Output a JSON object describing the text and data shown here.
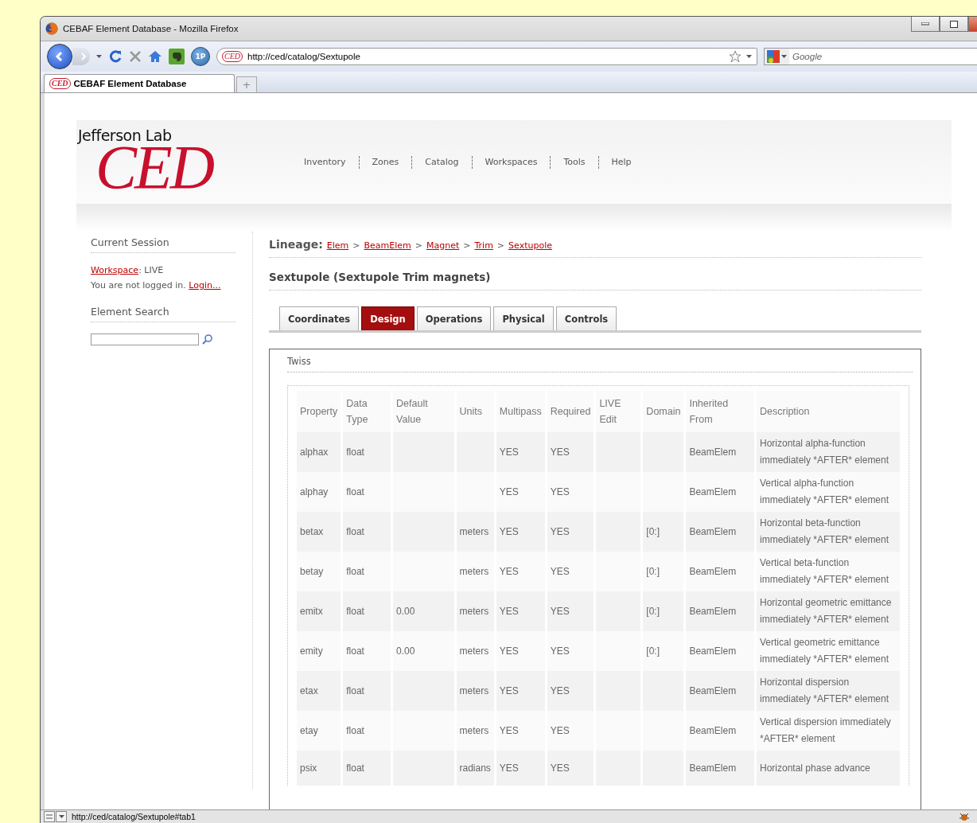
{
  "window": {
    "title": "CEBAF Element Database - Mozilla Firefox"
  },
  "toolbar": {
    "addon_label": "1P",
    "site_icon_text": "CED",
    "url": "http://ced/catalog/Sextupole",
    "search_placeholder": "Google"
  },
  "browser_tabs": [
    {
      "icon_text": "CED",
      "label": "CEBAF Element Database",
      "selected": true
    }
  ],
  "new_tab": "+",
  "header": {
    "logo_top": "Jefferson Lab",
    "logo_main": "CED",
    "nav": [
      "Inventory",
      "Zones",
      "Catalog",
      "Workspaces",
      "Tools",
      "Help"
    ]
  },
  "sidebar": {
    "session_title": "Current Session",
    "workspace_link": "Workspace",
    "workspace_value": ": LIVE",
    "login_text": "You are not logged in.",
    "login_link": "Login...",
    "search_title": "Element Search"
  },
  "lineage": {
    "label": "Lineage:",
    "crumbs": [
      "Elem",
      "BeamElem",
      "Magnet",
      "Trim",
      "Sextupole"
    ],
    "separator": ">"
  },
  "page_title": "Sextupole (Sextupole Trim magnets)",
  "tabs": [
    {
      "label": "Coordinates",
      "selected": false
    },
    {
      "label": "Design",
      "selected": true
    },
    {
      "label": "Operations",
      "selected": false
    },
    {
      "label": "Physical",
      "selected": false
    },
    {
      "label": "Controls",
      "selected": false
    }
  ],
  "panel": {
    "title": "Twiss",
    "columns": [
      "Property",
      "Data Type",
      "Default Value",
      "Units",
      "Multipass",
      "Required",
      "LIVE Edit",
      "Domain",
      "Inherited From",
      "Description"
    ],
    "rows": [
      {
        "property": "alphax",
        "data_type": "float",
        "multipass": "YES",
        "required": "YES",
        "inherited_from": "BeamElem",
        "description": "Horizontal alpha-function immediately *AFTER* element"
      },
      {
        "property": "alphay",
        "data_type": "float",
        "multipass": "YES",
        "required": "YES",
        "inherited_from": "BeamElem",
        "description": "Vertical alpha-function immediately *AFTER* element"
      },
      {
        "property": "betax",
        "data_type": "float",
        "units": "meters",
        "multipass": "YES",
        "required": "YES",
        "domain": "[0:]",
        "inherited_from": "BeamElem",
        "description": "Horizontal beta-function immediately *AFTER* element"
      },
      {
        "property": "betay",
        "data_type": "float",
        "units": "meters",
        "multipass": "YES",
        "required": "YES",
        "domain": "[0:]",
        "inherited_from": "BeamElem",
        "description": "Vertical beta-function immediately *AFTER* element"
      },
      {
        "property": "emitx",
        "data_type": "float",
        "default_value": "0.00",
        "units": "meters",
        "multipass": "YES",
        "required": "YES",
        "domain": "[0:]",
        "inherited_from": "BeamElem",
        "description": "Horizontal geometric emittance immediately *AFTER* element"
      },
      {
        "property": "emity",
        "data_type": "float",
        "default_value": "0.00",
        "units": "meters",
        "multipass": "YES",
        "required": "YES",
        "domain": "[0:]",
        "inherited_from": "BeamElem",
        "description": "Vertical geometric emittance immediately *AFTER* element"
      },
      {
        "property": "etax",
        "data_type": "float",
        "units": "meters",
        "multipass": "YES",
        "required": "YES",
        "inherited_from": "BeamElem",
        "description": "Horizontal dispersion immediately *AFTER* element"
      },
      {
        "property": "etay",
        "data_type": "float",
        "units": "meters",
        "multipass": "YES",
        "required": "YES",
        "inherited_from": "BeamElem",
        "description": "Vertical dispersion immediately *AFTER* element"
      },
      {
        "property": "psix",
        "data_type": "float",
        "units": "radians",
        "multipass": "YES",
        "required": "YES",
        "inherited_from": "BeamElem",
        "description": "Horizontal phase advance"
      }
    ]
  },
  "status_bar": {
    "url": "http://ced/catalog/Sextupole#tab1"
  }
}
